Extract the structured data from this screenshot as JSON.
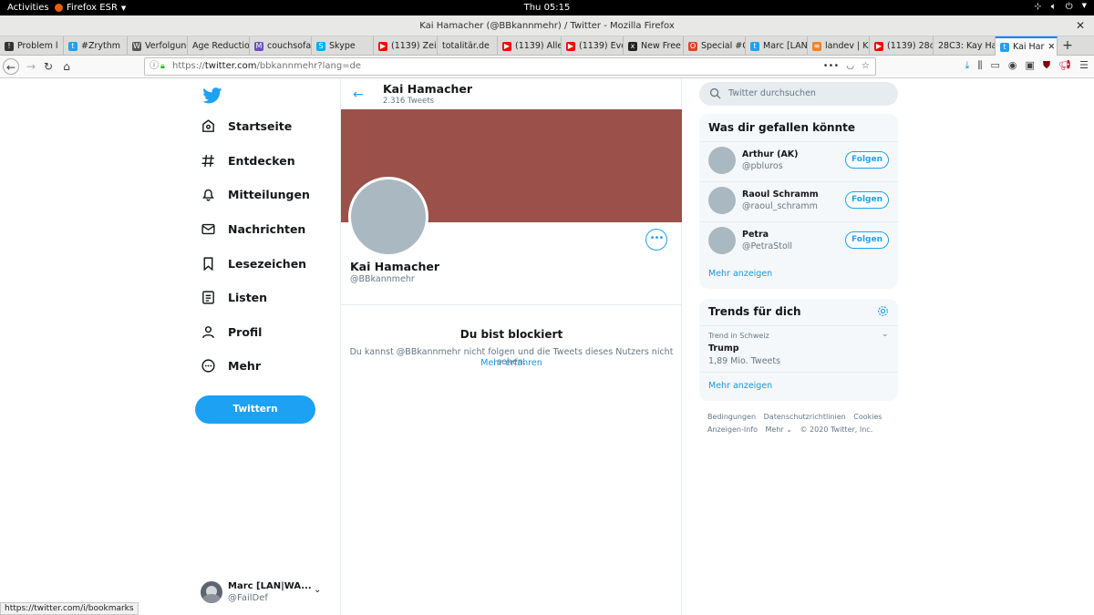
{
  "gnome": {
    "activities": "Activities",
    "app": "Firefox ESR",
    "clock": "Thu 05:15"
  },
  "window": {
    "title": "Kai Hamacher (@BBkannmehr) / Twitter - Mozilla Firefox"
  },
  "tabs": [
    {
      "label": "Problem l",
      "icon": "warning-icon",
      "color": "#333333"
    },
    {
      "label": "#Zrythm",
      "icon": "twitter-icon",
      "color": "#1da1f2"
    },
    {
      "label": "Verfolgun",
      "icon": "wikipedia-icon",
      "color": "#555555"
    },
    {
      "label": "Age Reductio",
      "icon": "none",
      "color": "#dcdcdb"
    },
    {
      "label": "couchsofa",
      "icon": "mastodon-icon",
      "color": "#6b4fbb"
    },
    {
      "label": "Skype",
      "icon": "skype-icon",
      "color": "#00aff0"
    },
    {
      "label": "(1139) Zei",
      "icon": "youtube-icon",
      "color": "#ff0000"
    },
    {
      "label": "totalitär.de",
      "icon": "none",
      "color": "#dcdcdb"
    },
    {
      "label": "(1139) Alle",
      "icon": "youtube-icon",
      "color": "#ff0000"
    },
    {
      "label": "(1139) Eve",
      "icon": "youtube-icon",
      "color": "#ff0000"
    },
    {
      "label": "New Free",
      "icon": "wix-icon",
      "color": "#222222"
    },
    {
      "label": "Special #C",
      "icon": "opera-icon",
      "color": "#e0412e"
    },
    {
      "label": "Marc [LAN",
      "icon": "twitter-icon",
      "color": "#1da1f2"
    },
    {
      "label": "landev | K",
      "icon": "stack-icon",
      "color": "#f48024"
    },
    {
      "label": "(1139) 28c",
      "icon": "youtube-icon",
      "color": "#ff0000"
    },
    {
      "label": "28C3: Kay Ha",
      "icon": "none",
      "color": "#dcdcdb"
    },
    {
      "label": "Kai Har",
      "icon": "twitter-icon",
      "color": "#1da1f2",
      "active": true
    }
  ],
  "urlbar": {
    "prefix": "https://",
    "host": "twitter.com",
    "path": "/bbkannmehr?lang=de"
  },
  "nav": {
    "items": [
      {
        "label": "Startseite",
        "icon": "home-icon"
      },
      {
        "label": "Entdecken",
        "icon": "hashtag-icon"
      },
      {
        "label": "Mitteilungen",
        "icon": "bell-icon"
      },
      {
        "label": "Nachrichten",
        "icon": "mail-icon"
      },
      {
        "label": "Lesezeichen",
        "icon": "bookmark-icon"
      },
      {
        "label": "Listen",
        "icon": "list-icon"
      },
      {
        "label": "Profil",
        "icon": "person-icon"
      },
      {
        "label": "Mehr",
        "icon": "more-icon"
      }
    ],
    "tweet_label": "Twittern"
  },
  "account": {
    "name": "Marc [LAN|WA...",
    "handle": "@FailDef"
  },
  "profile": {
    "header_name": "Kai Hamacher",
    "tweet_count": "2.316 Tweets",
    "name": "Kai Hamacher",
    "handle": "@BBkannmehr",
    "banner_color": "#9b5149",
    "blocked_title": "Du bist blockiert",
    "blocked_text": "Du kannst @BBkannmehr nicht folgen und die Tweets dieses Nutzers nicht sehen.",
    "blocked_link": "Mehr erfahren"
  },
  "search": {
    "placeholder": "Twitter durchsuchen"
  },
  "suggestions": {
    "title": "Was dir gefallen könnte",
    "follow_label": "Folgen",
    "more": "Mehr anzeigen",
    "items": [
      {
        "name": "Arthur (AK)",
        "handle": "@pbluros"
      },
      {
        "name": "Raoul Schramm",
        "handle": "@raoul_schramm"
      },
      {
        "name": "Petra",
        "handle": "@PetraStoll"
      }
    ]
  },
  "trends": {
    "title": "Trends für dich",
    "meta": "Trend in Schweiz",
    "name": "Trump",
    "count": "1,89 Mio. Tweets",
    "more": "Mehr anzeigen"
  },
  "footer": {
    "links": [
      "Bedingungen",
      "Datenschutzrichtlinien",
      "Cookies"
    ],
    "ads": "Anzeigen-Info",
    "more": "Mehr ⌄",
    "copyright": "© 2020 Twitter, Inc."
  },
  "status_url": "https://twitter.com/i/bookmarks",
  "colors": {
    "accent": "#1da1f2",
    "banner": "#9b5149"
  }
}
